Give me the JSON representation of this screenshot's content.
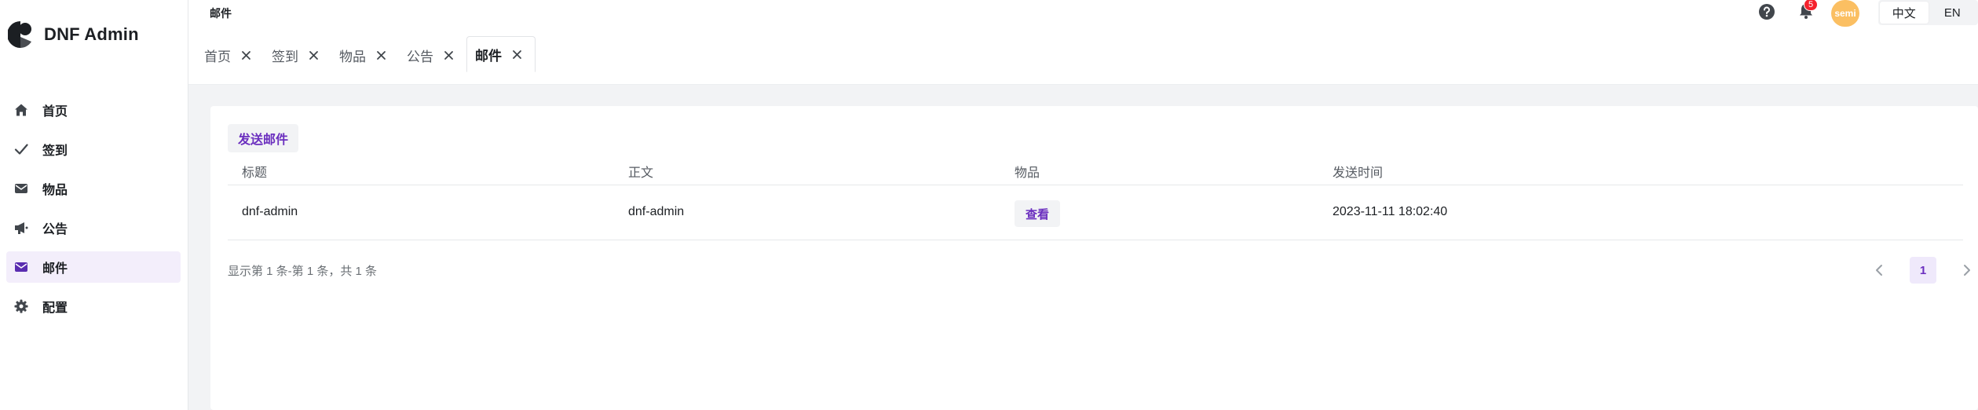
{
  "app": {
    "brand": "DNF Admin"
  },
  "sidebar": {
    "items": [
      {
        "label": "首页",
        "icon": "home-icon"
      },
      {
        "label": "签到",
        "icon": "check-icon"
      },
      {
        "label": "物品",
        "icon": "mail-icon"
      },
      {
        "label": "公告",
        "icon": "megaphone-icon"
      },
      {
        "label": "邮件",
        "icon": "mail-icon",
        "active": true
      },
      {
        "label": "配置",
        "icon": "gear-icon"
      }
    ]
  },
  "header": {
    "breadcrumb": "邮件",
    "notification_count": "5",
    "avatar_text": "semi",
    "lang": {
      "zh": "中文",
      "en": "EN",
      "selected": "中文"
    }
  },
  "tabs": [
    {
      "label": "首页"
    },
    {
      "label": "签到"
    },
    {
      "label": "物品"
    },
    {
      "label": "公告"
    },
    {
      "label": "邮件",
      "active": true
    }
  ],
  "toolbar": {
    "send_label": "发送邮件"
  },
  "table": {
    "columns": [
      "标题",
      "正文",
      "物品",
      "发送时间"
    ],
    "rows": [
      {
        "title": "dnf-admin",
        "body": "dnf-admin",
        "items_action": "查看",
        "sent_at": "2023-11-11 18:02:40"
      }
    ]
  },
  "pagination": {
    "summary": "显示第 1 条-第 1 条，共 1 条",
    "current_page": "1"
  },
  "colors": {
    "accent": "#6b2fbf",
    "active_bg": "#f3eefb",
    "badge": "#f5222d",
    "avatar": "#fbbf62"
  }
}
